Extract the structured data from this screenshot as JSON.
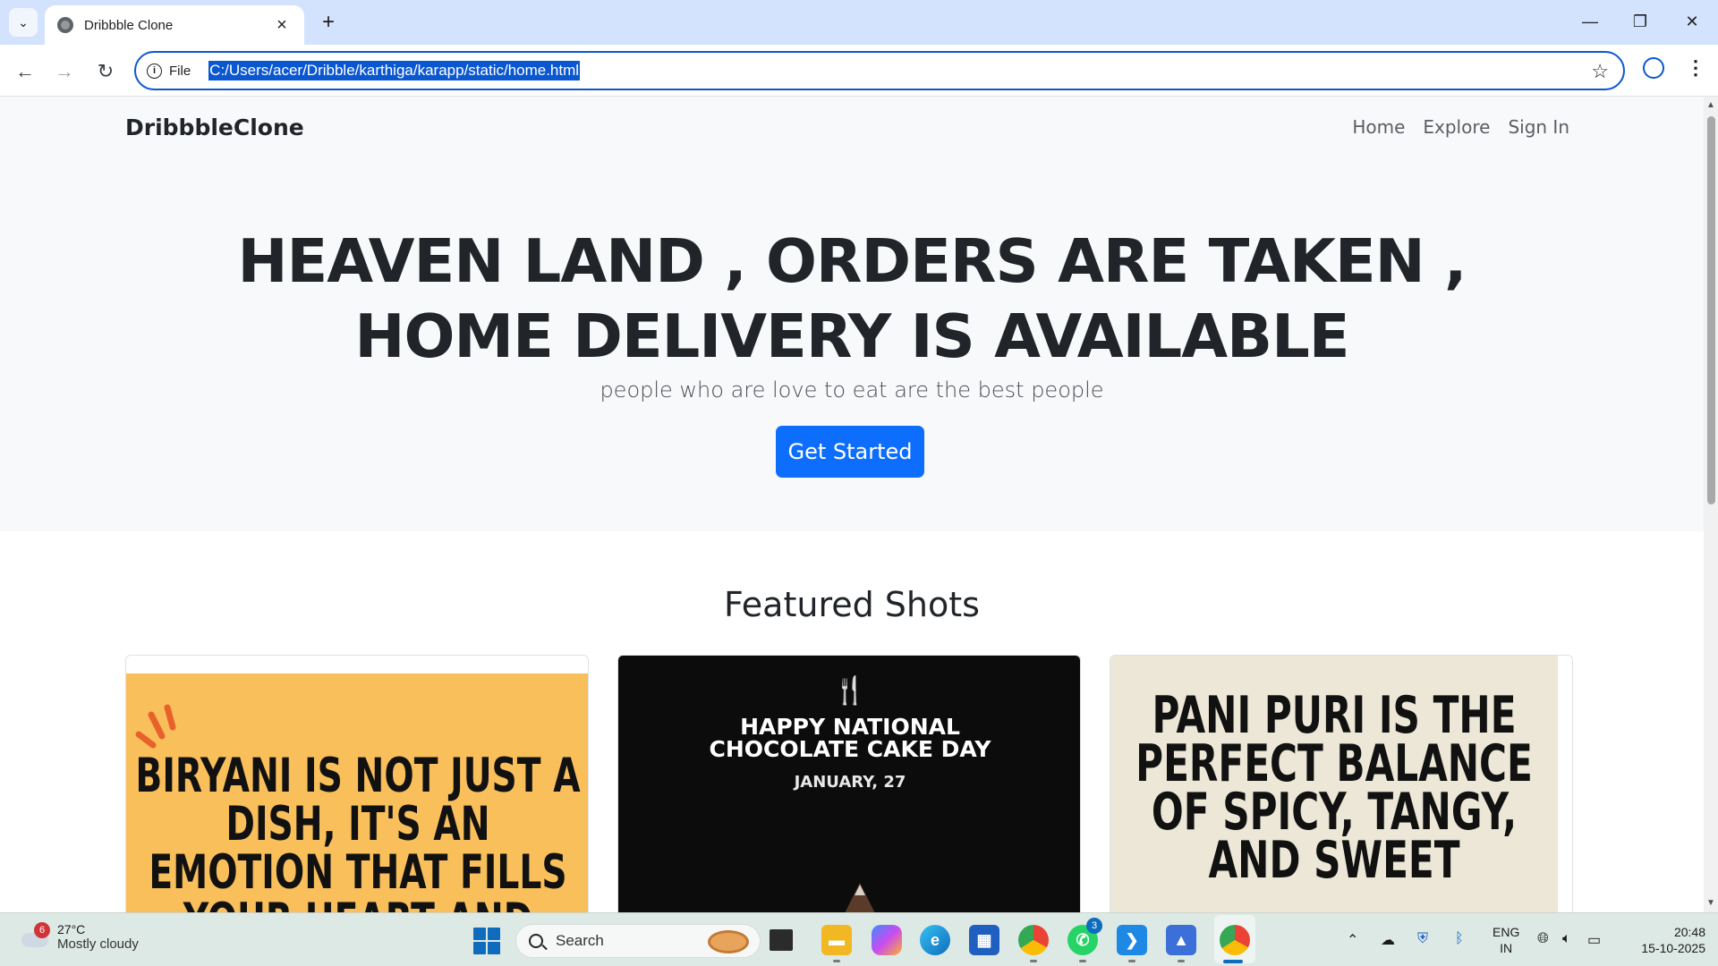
{
  "browser": {
    "tab_title": "Dribbble Clone",
    "new_tab_label": "+",
    "site_info_label": "File",
    "url": "C:/Users/acer/Dribble/karthiga/karapp/static/home.html"
  },
  "site": {
    "brand": "DribbbleClone",
    "nav": [
      "Home",
      "Explore",
      "Sign In"
    ],
    "hero_title": "HEAVEN LAND , ORDERS ARE TAKEN , HOME DELIVERY IS AVAILABLE",
    "hero_subtitle": "people who are love to eat are the best people",
    "cta_label": "Get Started",
    "section_title": "Featured Shots",
    "cards": [
      {
        "text": "BIRYANI IS NOT JUST A DISH, IT'S AN EMOTION THAT FILLS YOUR HEART AND YOUR STOMACH"
      },
      {
        "headline_1": "HAPPY NATIONAL",
        "headline_2": "CHOCOLATE CAKE DAY",
        "date": "JANUARY, 27"
      },
      {
        "text": "PANI PURI IS THE PERFECT BALANCE OF SPICY, TANGY, AND SWEET"
      }
    ]
  },
  "taskbar": {
    "weather_badge": "6",
    "temperature": "27°C",
    "condition": "Mostly cloudy",
    "search_label": "Search",
    "whatsapp_badge": "3",
    "lang_1": "ENG",
    "lang_2": "IN",
    "time": "20:48",
    "date": "15-10-2025"
  },
  "colors": {
    "primary_button": "#0d6efd",
    "omnibox_focus": "#0b57d0",
    "card1_bg": "#f9bf5b",
    "card2_bg": "#0c0c0c",
    "card3_bg": "#ece7d6"
  }
}
